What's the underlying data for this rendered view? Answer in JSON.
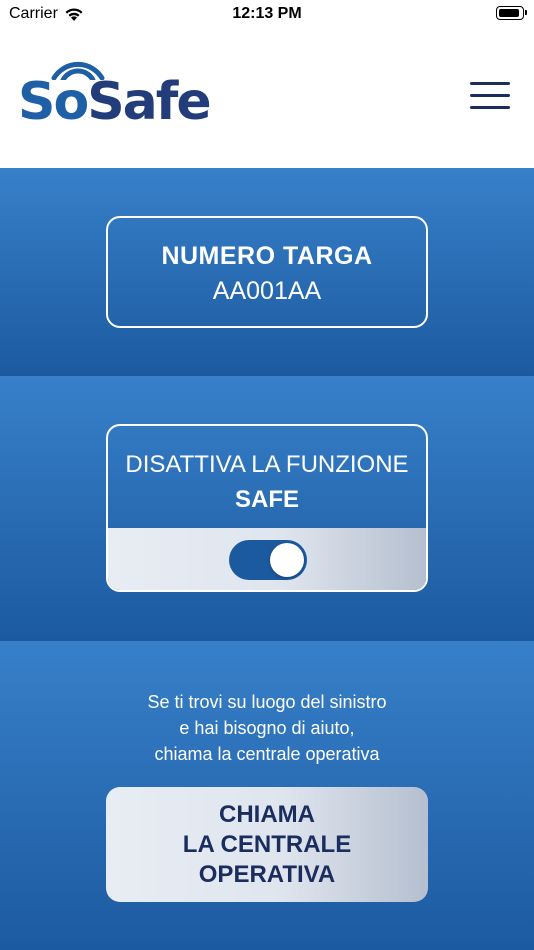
{
  "status_bar": {
    "carrier": "Carrier",
    "time": "12:13 PM"
  },
  "header": {
    "logo": {
      "part1": "S",
      "part2": "o",
      "part3": "Safe"
    },
    "menu_icon": "hamburger-icon"
  },
  "plate": {
    "label": "NUMERO TARGA",
    "value": "AA001AA"
  },
  "safe_function": {
    "line1": "DISATTIVA LA FUNZIONE",
    "line2": "SAFE",
    "toggle_on": true
  },
  "help": {
    "line1": "Se ti trovi su luogo del sinistro",
    "line2": "e hai bisogno di aiuto,",
    "line3": "chiama la centrale operativa"
  },
  "call_button": {
    "line1": "CHIAMA",
    "line2": "LA CENTRALE",
    "line3": "OPERATIVA"
  },
  "colors": {
    "primary_blue": "#1c5aa0",
    "light_blue": "#3780c9",
    "navy": "#1b2d5e",
    "logo_blue": "#1f5fa6"
  }
}
